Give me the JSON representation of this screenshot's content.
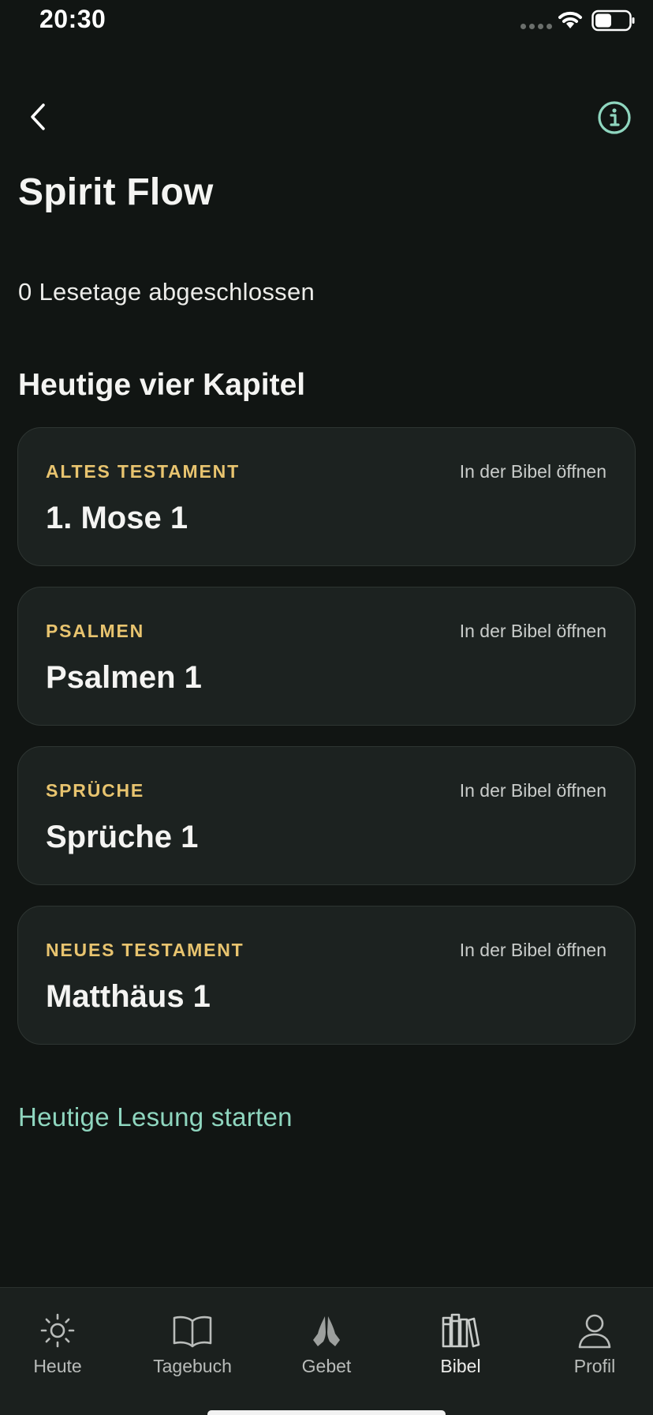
{
  "status_bar": {
    "time": "20:30",
    "icons": [
      "cellular-signal-icon",
      "wifi-icon",
      "battery-icon"
    ]
  },
  "header": {
    "back_icon": "chevron-left-icon",
    "info_icon": "info-circle-icon",
    "title": "Spirit Flow"
  },
  "progress": {
    "text": "0 Lesetage abgeschlossen"
  },
  "section": {
    "heading": "Heutige vier Kapitel"
  },
  "cards": [
    {
      "category": "ALTES TESTAMENT",
      "chapter": "1. Mose 1",
      "link": "In der Bibel öffnen"
    },
    {
      "category": "PSALMEN",
      "chapter": "Psalmen 1",
      "link": "In der Bibel öffnen"
    },
    {
      "category": "SPRÜCHE",
      "chapter": "Sprüche 1",
      "link": "In der Bibel öffnen"
    },
    {
      "category": "NEUES TESTAMENT",
      "chapter": "Matthäus 1",
      "link": "In der Bibel öffnen"
    }
  ],
  "start_button": {
    "label": "Heutige Lesung starten"
  },
  "tab_bar": {
    "tabs": [
      {
        "label": "Heute",
        "icon": "sun-icon"
      },
      {
        "label": "Tagebuch",
        "icon": "book-open-icon"
      },
      {
        "label": "Gebet",
        "icon": "praying-hands-icon"
      },
      {
        "label": "Bibel",
        "icon": "books-icon"
      },
      {
        "label": "Profil",
        "icon": "person-icon"
      }
    ],
    "active": "Bibel"
  },
  "colors": {
    "background": "#111513",
    "card_background": "#1c2220",
    "category_gold": "#e8c46f",
    "accent_mint": "#8fd6bf"
  }
}
